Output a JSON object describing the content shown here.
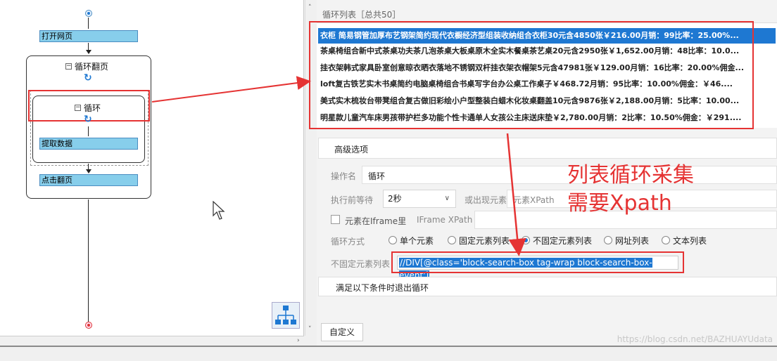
{
  "flow": {
    "open_page": "打开网页",
    "loop_page": "循环翻页",
    "loop": "循环",
    "extract": "提取数据",
    "next_page": "点击翻页"
  },
  "list": {
    "header": "循环列表［总共50］",
    "rows": [
      "衣柜  简易钢管加厚布艺钢架简约现代衣橱经济型组装收纳组合衣柜30元含4850张￥216.00月销：99比率：25.00%...",
      "茶桌椅组合新中式茶桌功夫茶几泡茶桌大板桌原木全实木餐桌茶艺桌20元含2950张￥1,652.00月销：48比率：10.0...",
      "挂衣架韩式家具卧室创意晾衣晒衣落地不锈钢双杆挂衣架衣帽架5元含47981张￥129.00月销：16比率：20.00%佣金...",
      "loft复古铁艺实木书桌简约电脑桌椅组合书桌写字台办公桌工作桌子￥468.72月销：95比率：10.00%佣金：￥46....",
      "美式实木梳妆台带凳组合复古做旧彩绘小户型整装白蜡木化妆桌翻盖10元含9876张￥2,188.00月销：5比率：10.00...",
      "明星款儿童汽车床男孩带护栏多功能个性卡通单人女孩公主床送床垫￥2,780.00月销：2比率：10.50%佣金：￥291...."
    ]
  },
  "form": {
    "advanced_tab": "高级选项",
    "op_name_label": "操作名",
    "op_name_value": "循环",
    "wait_label": "执行前等待",
    "wait_value": "2秒",
    "appear_label": "或出现元素",
    "appear_placeholder": "元素XPath",
    "iframe_label": "元素在Iframe里",
    "iframe_xpath_label": "IFrame XPath",
    "loop_mode_label": "循环方式",
    "loop_modes": [
      "单个元素",
      "固定元素列表",
      "不固定元素列表",
      "网址列表",
      "文本列表"
    ],
    "selected_mode": "不固定元素列表",
    "unfixed_list_label": "不固定元素列表",
    "xpath_value": "//DIV[@class='block-search-box tag-wrap block-search-box-event']",
    "exit_condition": "满足以下条件时退出循环",
    "custom_button": "自定义"
  },
  "annotation": {
    "line1": "列表循环采集",
    "line2": "需要Xpath"
  },
  "watermark": "https://blog.csdn.net/BAZHUAYUdata",
  "colors": {
    "accent": "#1e78d2",
    "node": "#87ceeb",
    "annotation": "#e53333"
  }
}
